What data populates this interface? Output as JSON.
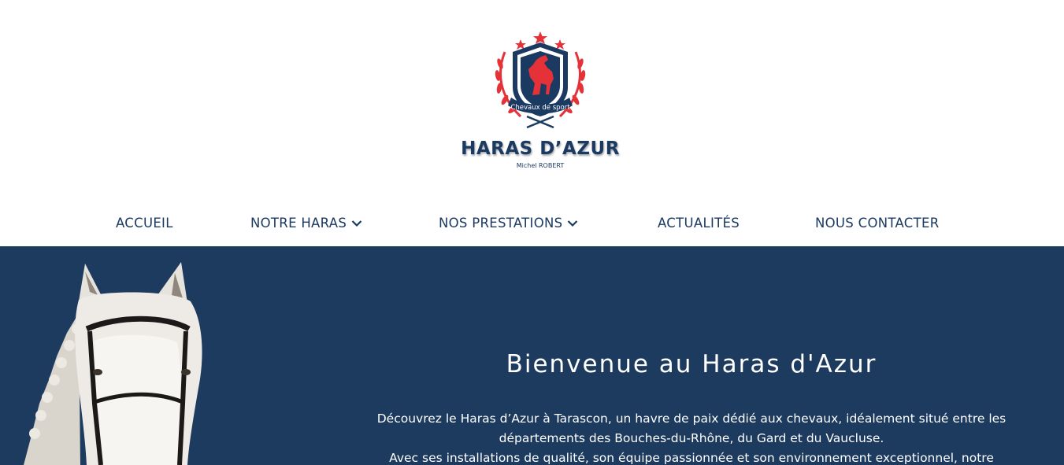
{
  "brand": {
    "name": "HARAS D’AZUR",
    "subtitle": "Michel ROBERT",
    "badge_text": "Chevaux de sport",
    "colors": {
      "navy": "#1b3a62",
      "red": "#e53238",
      "hero_bg": "#1d3a5f"
    }
  },
  "nav": {
    "items": [
      {
        "label": "ACCUEIL",
        "has_dropdown": false
      },
      {
        "label": "NOTRE HARAS",
        "has_dropdown": true
      },
      {
        "label": "NOS PRESTATIONS",
        "has_dropdown": true
      },
      {
        "label": "ACTUALITÉS",
        "has_dropdown": false
      },
      {
        "label": "NOUS CONTACTER",
        "has_dropdown": false
      }
    ],
    "dropdown_icon": "chevron-down-icon"
  },
  "hero": {
    "title": "Bienvenue au Haras d'Azur",
    "paragraph_line1": "Découvrez le Haras d’Azur à Tarascon, un havre de paix dédié aux chevaux, idéalement situé entre les",
    "paragraph_line2": "départements des Bouches-du-Rhône, du Gard et du Vaucluse.",
    "paragraph_line3": "Avec ses installations de qualité, son équipe passionnée et son environnement exceptionnel, notre",
    "image": "white-horse-head-photo"
  }
}
